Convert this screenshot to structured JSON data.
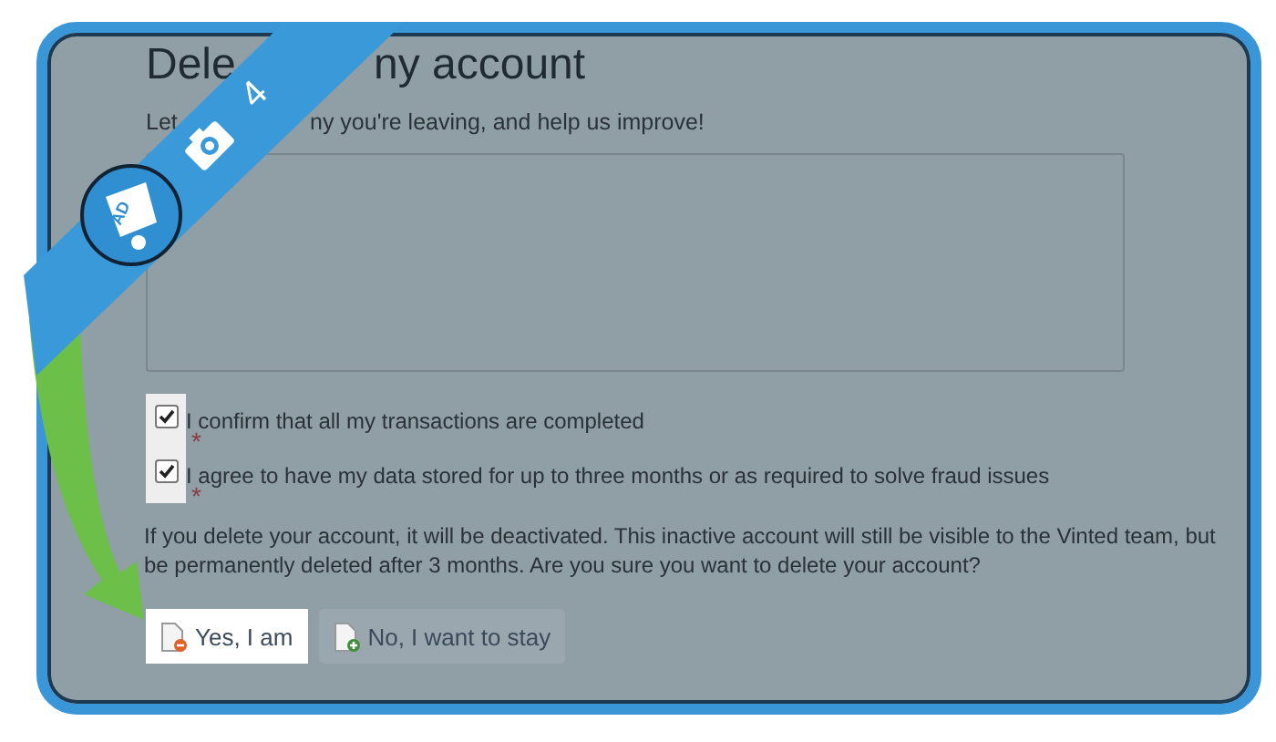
{
  "ribbon": {
    "badge": "AD",
    "step": "4"
  },
  "title_parts": [
    "Dele",
    "ny account"
  ],
  "intro_parts": [
    "Let",
    "ny you're leaving, and help us improve!"
  ],
  "checkboxes": [
    {
      "label": "I confirm that all my transactions are completed",
      "checked": true,
      "highlighted": true,
      "required": "*"
    },
    {
      "label": "I agree to have my data stored for up to three months or as required to solve fraud issues",
      "checked": true,
      "highlighted": true,
      "required": "*"
    }
  ],
  "notice": "If you delete your account, it will be deactivated. This inactive account will still be visible to the Vinted team, but be permanently deleted after 3 months. Are you sure you want to delete your account?",
  "buttons": [
    {
      "label": "Yes, I am",
      "kind": "delete",
      "highlighted": true
    },
    {
      "label": "No, I want to stay",
      "kind": "stay",
      "highlighted": false
    }
  ]
}
